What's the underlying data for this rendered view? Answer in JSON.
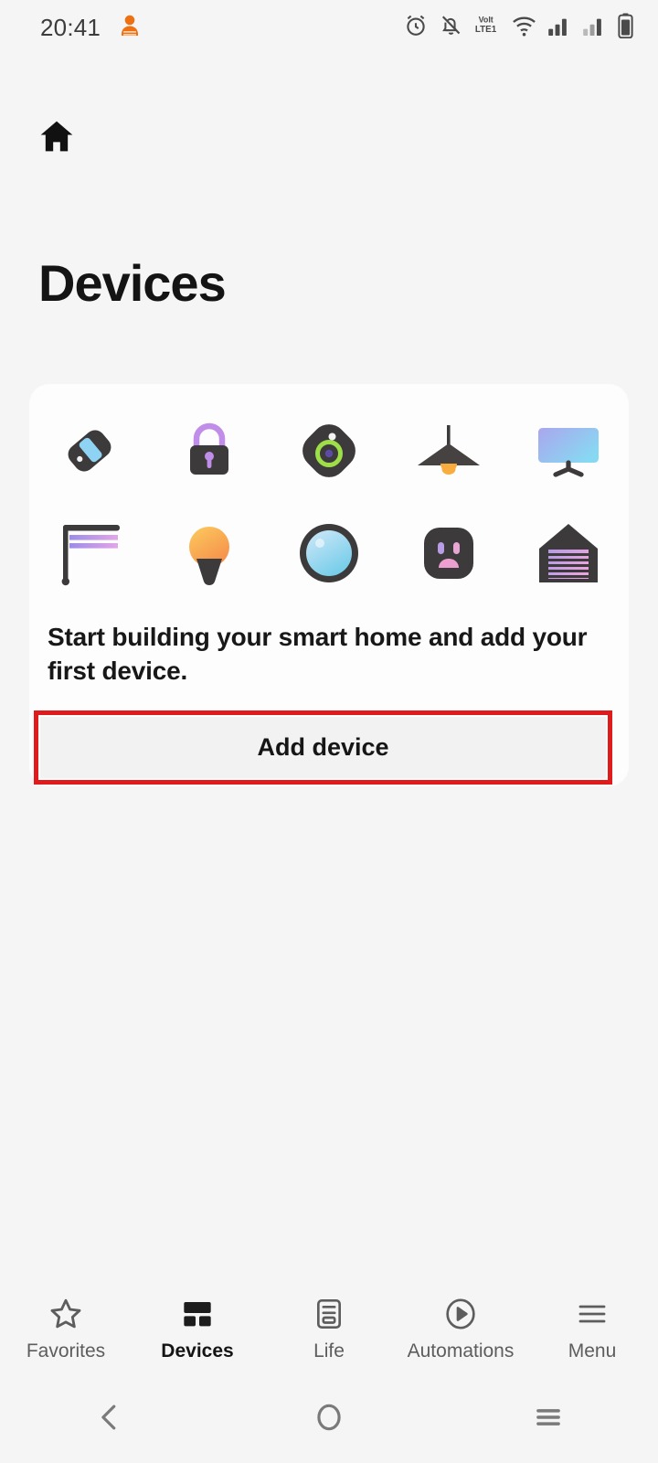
{
  "status_bar": {
    "time": "20:41",
    "left_icons": [
      {
        "name": "notification-badge-icon",
        "label": "app notification"
      }
    ],
    "right_icons": [
      {
        "name": "alarm-icon",
        "label": "Alarm set"
      },
      {
        "name": "notifications-muted-icon",
        "label": "Silent"
      },
      {
        "name": "volte-icon",
        "label": "VoLTE1"
      },
      {
        "name": "wifi-icon",
        "label": "Wi-Fi connected"
      },
      {
        "name": "signal-sim1-icon",
        "label": "SIM 1 signal"
      },
      {
        "name": "signal-sim2-icon",
        "label": "SIM 2 signal"
      },
      {
        "name": "battery-icon",
        "label": "Battery"
      }
    ]
  },
  "header": {
    "home_icon": "home-icon",
    "title": "Devices"
  },
  "card": {
    "message": "Start building your smart home and add your first device.",
    "add_button_label": "Add device",
    "highlight_color": "#e01b1b",
    "device_icons": [
      {
        "name": "sensor-tag-icon",
        "label": "Sensor"
      },
      {
        "name": "smart-lock-icon",
        "label": "Smart lock"
      },
      {
        "name": "camera-icon",
        "label": "Camera"
      },
      {
        "name": "pendant-lamp-icon",
        "label": "Ceiling lamp"
      },
      {
        "name": "tv-icon",
        "label": "TV"
      },
      {
        "name": "curtain-icon",
        "label": "Curtain"
      },
      {
        "name": "light-bulb-icon",
        "label": "Light bulb"
      },
      {
        "name": "round-sensor-icon",
        "label": "Motion sensor"
      },
      {
        "name": "power-socket-icon",
        "label": "Socket"
      },
      {
        "name": "garage-door-icon",
        "label": "Garage door"
      }
    ]
  },
  "tab_bar": {
    "active_index": 1,
    "tabs": [
      {
        "label": "Favorites",
        "icon": "star-icon"
      },
      {
        "label": "Devices",
        "icon": "grid-icon"
      },
      {
        "label": "Life",
        "icon": "document-icon"
      },
      {
        "label": "Automations",
        "icon": "play-circle-icon"
      },
      {
        "label": "Menu",
        "icon": "hamburger-icon"
      }
    ]
  },
  "system_nav": {
    "buttons": [
      {
        "name": "back-icon",
        "label": "Back"
      },
      {
        "name": "home-circle-icon",
        "label": "Home"
      },
      {
        "name": "recents-icon",
        "label": "Recents"
      }
    ]
  }
}
